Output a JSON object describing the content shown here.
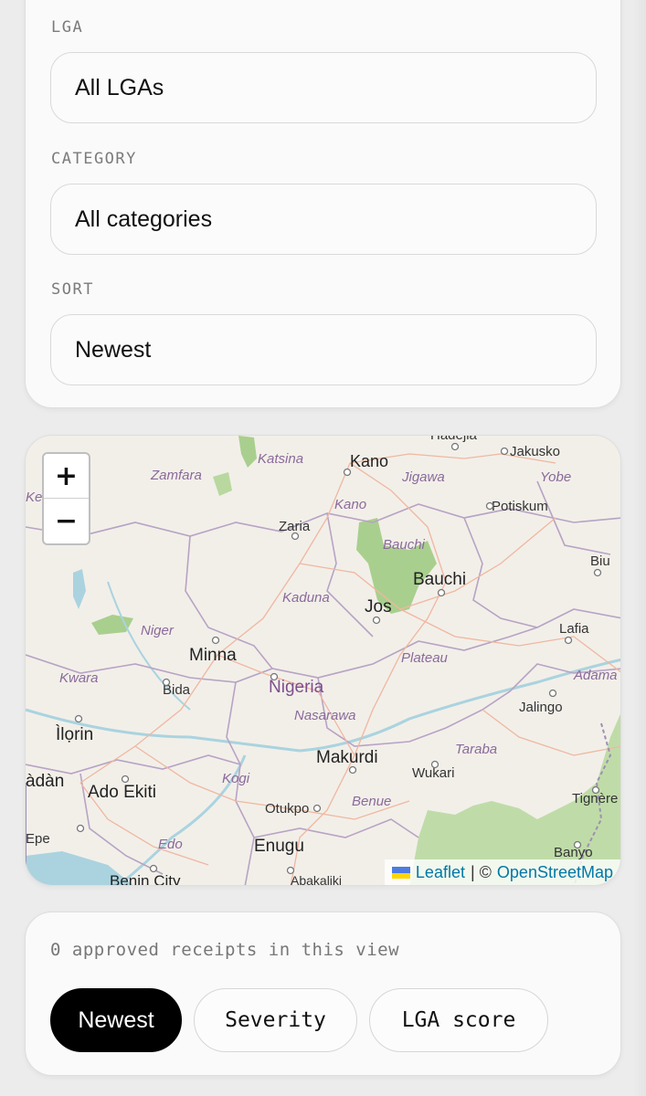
{
  "filters": {
    "lga": {
      "label": "LGA",
      "value": "All LGAs"
    },
    "category": {
      "label": "CATEGORY",
      "value": "All categories"
    },
    "sort": {
      "label": "SORT",
      "value": "Newest"
    }
  },
  "map": {
    "zoom_in": "+",
    "zoom_out": "−",
    "attribution": {
      "leaflet": "Leaflet",
      "separator": "| ©",
      "osm": "OpenStreetMap"
    },
    "labels": {
      "nigeria": "Nigeria",
      "kano_city": "Kano",
      "jakusko": "Jakusko",
      "katsina": "Katsina",
      "zamfara": "Zamfara",
      "jigawa": "Jigawa",
      "yobe": "Yobe",
      "kano_state": "Kano",
      "potiskum": "Potiskum",
      "zaria": "Zaria",
      "bauchi_state": "Bauchi",
      "bauchi_city": "Bauchi",
      "biu": "Biu",
      "kaduna": "Kaduna",
      "jos": "Jos",
      "niger": "Niger",
      "minna": "Minna",
      "plateau": "Plateau",
      "lafia": "Lafia",
      "kwara": "Kwara",
      "bida": "Bida",
      "adamawa": "Adama",
      "nasarawa": "Nasarawa",
      "jalingo": "Jalingo",
      "ilorin": "Ìlọrin",
      "taraba": "Taraba",
      "makurdi": "Makurdi",
      "ibadan": "àdàn",
      "wukari": "Wukari",
      "ado_ekiti": "Ado Ekiti",
      "kogi": "Kogi",
      "benue": "Benue",
      "tignere": "Tignère",
      "otukpo": "Otukpo",
      "epe": "Epe",
      "edo": "Edo",
      "enugu": "Enugu",
      "banyo": "Banyo",
      "benin_city": "Benin City",
      "abakaliki": "Abakaliki",
      "kebbi": "Keb",
      "hadejia": "Hadejia"
    }
  },
  "results": {
    "count_text": "0 approved receipts in this view",
    "sort_options": [
      "Newest",
      "Severity",
      "LGA score"
    ]
  }
}
